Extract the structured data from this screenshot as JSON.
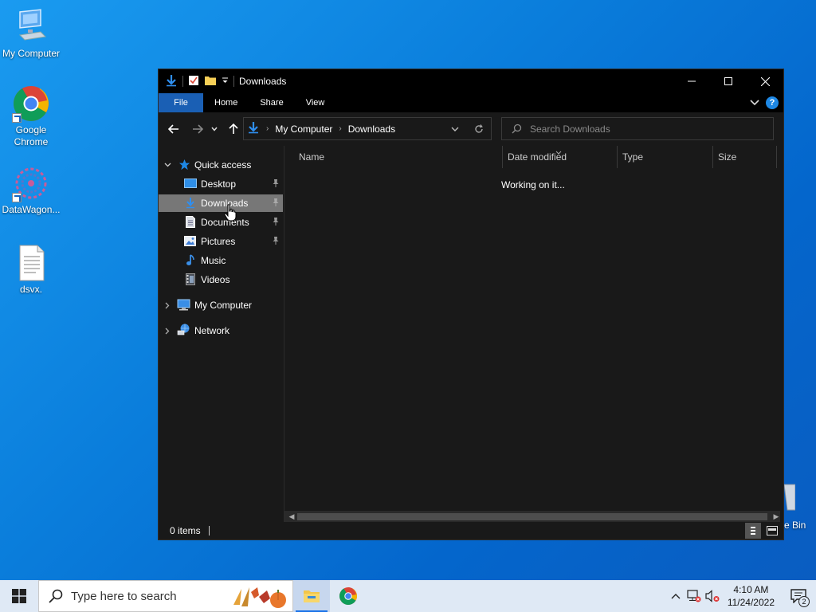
{
  "desktop": {
    "icons": [
      {
        "label": "My Computer"
      },
      {
        "label": "Google Chrome"
      },
      {
        "label": "DataWagon..."
      },
      {
        "label": "dsvx."
      }
    ],
    "recycle_label": "e Bin"
  },
  "window": {
    "title": "Downloads",
    "ribbon_tabs": [
      "File",
      "Home",
      "Share",
      "View"
    ],
    "help_label": "?",
    "address": {
      "crumbs": [
        "My Computer",
        "Downloads"
      ]
    },
    "search": {
      "placeholder": "Search Downloads"
    },
    "sidebar": {
      "quick_access": "Quick access",
      "items": [
        "Desktop",
        "Downloads",
        "Documents",
        "Pictures",
        "Music",
        "Videos"
      ],
      "my_computer": "My Computer",
      "network": "Network"
    },
    "columns": [
      "Name",
      "Date modified",
      "Type",
      "Size"
    ],
    "status_message": "Working on it...",
    "item_count": "0 items"
  },
  "taskbar": {
    "search_placeholder": "Type here to search",
    "time": "4:10 AM",
    "date": "11/24/2022",
    "notification_count": "2"
  },
  "colors": {
    "accent": "#1a5fb4",
    "selected_item": "#777777",
    "window_bg": "#191919"
  }
}
